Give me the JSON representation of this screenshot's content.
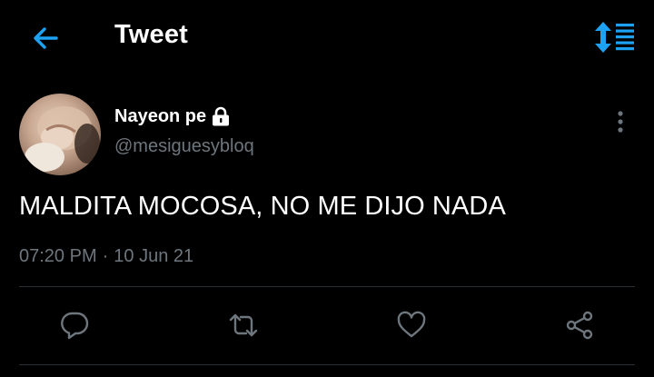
{
  "header": {
    "title": "Tweet",
    "back_icon": "arrow-left-icon",
    "sort_icon": "sort-order-icon",
    "accent_color": "#1da1f2"
  },
  "tweet": {
    "author_name": "Nayeon pe",
    "protected_icon": "lock-icon",
    "handle": "@mesiguesybloq",
    "text": "MALDITA MOCOSA, NO ME DIJO NADA",
    "time": "07:20 PM",
    "separator": "·",
    "date": "10 Jun 21"
  },
  "actions": [
    {
      "name": "reply",
      "icon": "reply-icon"
    },
    {
      "name": "retweet",
      "icon": "retweet-icon"
    },
    {
      "name": "like",
      "icon": "heart-icon"
    },
    {
      "name": "share",
      "icon": "share-icon"
    }
  ],
  "colors": {
    "background": "#000000",
    "text": "#ffffff",
    "secondary_text": "#6e767d",
    "icon": "#6e767d",
    "divider": "#2a2f33"
  }
}
